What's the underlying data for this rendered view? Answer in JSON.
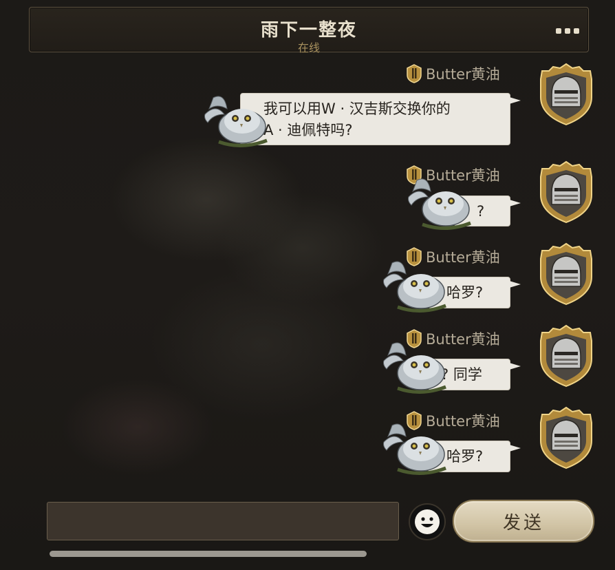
{
  "header": {
    "title": "雨下一整夜",
    "status": "在线"
  },
  "messages": [
    {
      "sender": "Butter黄油",
      "text_lines": [
        "我可以用W · 汉吉斯交换你的",
        "A · 迪佩特吗?"
      ]
    },
    {
      "sender": "Butter黄油",
      "text_lines": [
        "?"
      ]
    },
    {
      "sender": "Butter黄油",
      "text_lines": [
        "哈罗?"
      ]
    },
    {
      "sender": "Butter黄油",
      "text_lines": [
        "? 同学"
      ]
    },
    {
      "sender": "Butter黄油",
      "text_lines": [
        "哈罗?"
      ]
    }
  ],
  "input": {
    "value": "",
    "placeholder": ""
  },
  "buttons": {
    "send": "发送"
  },
  "icons": {
    "more": "more-dots-icon",
    "badge": "gold-rank-badge-icon",
    "avatar": "knight-helmet-avatar",
    "owl": "owl-sticker-decoration",
    "emoji": "smiley-face-icon"
  },
  "colors": {
    "accent_gold": "#a8915e",
    "bubble": "#ebe8e1",
    "send_button": "#d8ccb0"
  }
}
